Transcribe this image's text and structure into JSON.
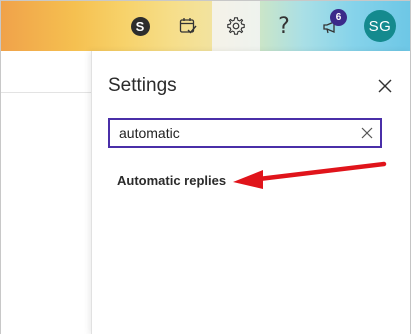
{
  "header": {
    "skype_letter": "S",
    "notification_count": "6",
    "avatar_initials": "SG"
  },
  "settings": {
    "title": "Settings",
    "search_value": "automatic",
    "results": [
      "Automatic replies"
    ]
  },
  "colors": {
    "accent": "#4a2fa8",
    "avatar_bg": "#148a8e",
    "arrow": "#e0141b"
  }
}
